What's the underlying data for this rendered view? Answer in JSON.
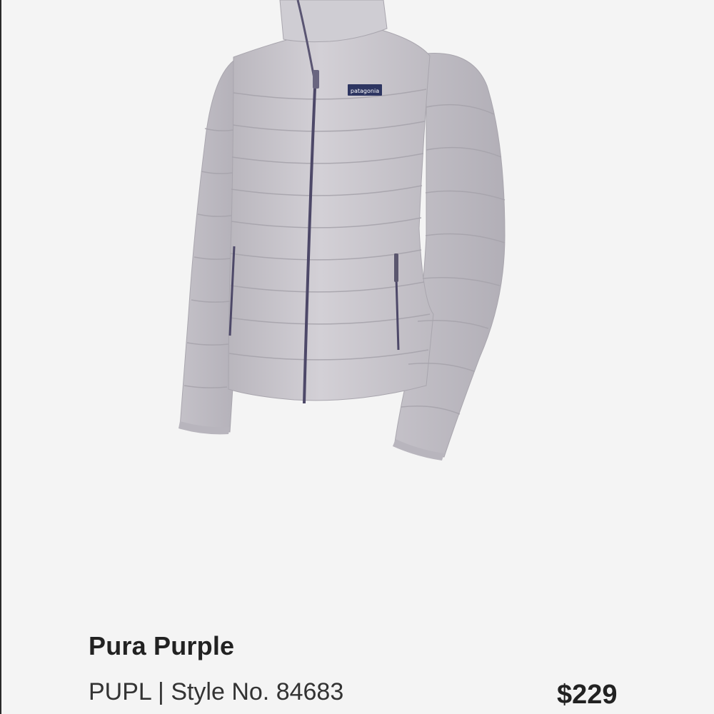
{
  "product": {
    "image_alt": "Down sweater jacket",
    "logo_text": "patagonia",
    "color_name": "Pura Purple",
    "color_code": "PUPL",
    "separator": "|",
    "style_label": "Style No. 84683",
    "price": "$229"
  },
  "colors": {
    "background": "#f4f4f4",
    "jacket": "#c9c6cc",
    "zipper": "#4d4868",
    "text": "#222222"
  }
}
